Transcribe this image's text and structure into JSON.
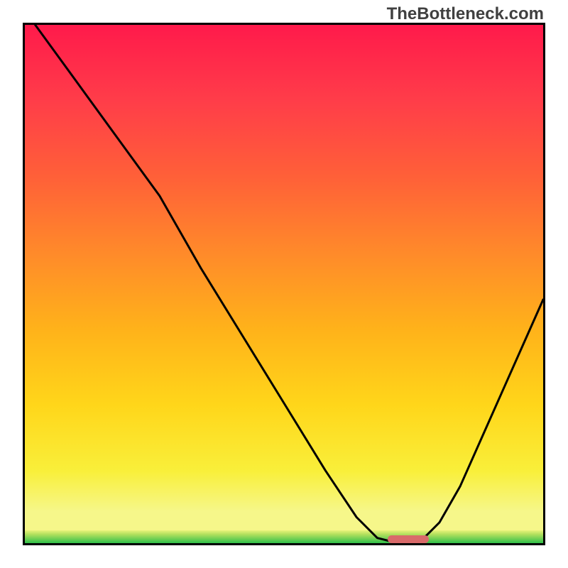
{
  "attribution": "TheBottleneck.com",
  "chart_data": {
    "type": "line",
    "title": "",
    "xlabel": "",
    "ylabel": "",
    "x_range": [
      0,
      100
    ],
    "y_range": [
      0,
      100
    ],
    "curve_note": "Approximate V-shaped bottleneck curve read from image; x is horizontal position (0=left edge, 100=right edge), y is bottleneck percentage (0=bottom/green, 100=top/red).",
    "series": [
      {
        "name": "bottleneck-curve",
        "x": [
          2,
          10,
          18,
          26,
          34,
          42,
          50,
          58,
          64,
          68,
          72,
          76,
          80,
          84,
          88,
          92,
          96,
          100
        ],
        "y": [
          100,
          89,
          78,
          67,
          53,
          40,
          27,
          14,
          5,
          1,
          0,
          0,
          4,
          11,
          20,
          29,
          38,
          47
        ]
      }
    ],
    "optimal_marker": {
      "x_start": 70,
      "x_end": 78,
      "y": 0
    },
    "gradient_stops": [
      {
        "offset": 0.0,
        "color": "#ff1a4b"
      },
      {
        "offset": 0.15,
        "color": "#ff3d49"
      },
      {
        "offset": 0.3,
        "color": "#ff6038"
      },
      {
        "offset": 0.45,
        "color": "#ff8a2a"
      },
      {
        "offset": 0.6,
        "color": "#ffb21a"
      },
      {
        "offset": 0.75,
        "color": "#ffd61a"
      },
      {
        "offset": 0.88,
        "color": "#f9ef3a"
      },
      {
        "offset": 0.96,
        "color": "#f6f78a"
      }
    ]
  }
}
